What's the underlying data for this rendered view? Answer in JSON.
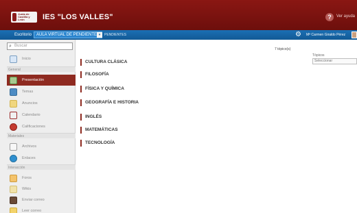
{
  "header": {
    "logo_text": "Junta de Castilla y León",
    "school_title": "IES \"LOS VALLES\"",
    "help_icon": "help-icon",
    "help_link": "Ver ayuda",
    "brand_color": "#7d1210"
  },
  "topbar": {
    "lead": "Escritorio",
    "current": "AULA VIRTUAL DE PENDIENTES",
    "sub": "PENDIENTES",
    "user_name": "Mª Carmen Giraldo Pérez",
    "color": "#1565a8"
  },
  "sidebar": {
    "search_placeholder": "Buscar",
    "items": [
      {
        "label": "Inicio",
        "icon": "home-icon",
        "active": false
      },
      {
        "section": "General"
      },
      {
        "label": "Presentación",
        "icon": "presentation-icon",
        "active": true
      },
      {
        "label": "Temas",
        "icon": "topics-icon",
        "active": false
      },
      {
        "label": "Anuncios",
        "icon": "announcements-icon",
        "active": false
      },
      {
        "label": "Calendario",
        "icon": "calendar-icon",
        "active": false
      },
      {
        "label": "Calificaciones",
        "icon": "grades-icon",
        "active": false
      },
      {
        "section": "Materiales"
      },
      {
        "label": "Archivos",
        "icon": "files-icon",
        "active": false
      },
      {
        "label": "Enlaces",
        "icon": "links-icon",
        "active": false
      },
      {
        "section": "Interacción"
      },
      {
        "label": "Foros",
        "icon": "forums-icon",
        "active": false
      },
      {
        "label": "Wikis",
        "icon": "wikis-icon",
        "active": false
      },
      {
        "label": "Enviar correo",
        "icon": "send-mail-icon",
        "active": false
      },
      {
        "label": "Leer correo",
        "icon": "read-mail-icon",
        "active": false
      }
    ]
  },
  "main": {
    "temas_count": "7 tópico(s)",
    "topic_label": "Tópicos",
    "topic_select": "Seleccionar",
    "courses": [
      "CULTURA CLÁSICA",
      "FILOSOFÍA",
      "FÍSICA Y QUÍMICA",
      "GEOGRAFÍA E HISTORIA",
      "INGLÉS",
      "MATEMÁTICAS",
      "TECNOLOGÍA"
    ]
  }
}
